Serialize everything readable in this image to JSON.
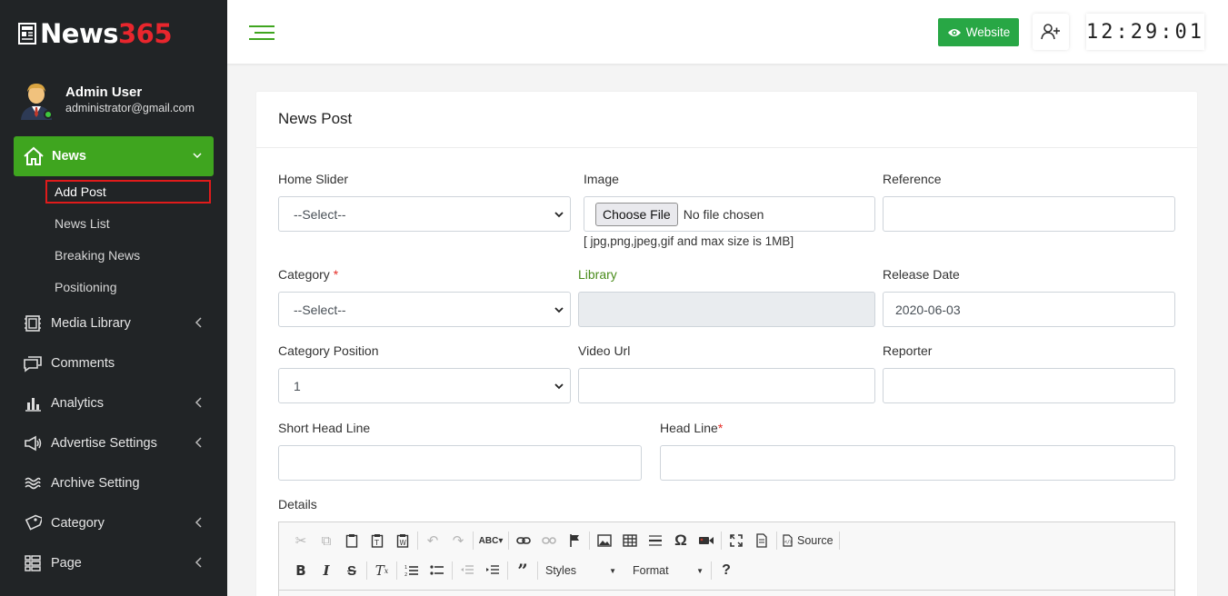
{
  "brand": {
    "name_part1": "News",
    "name_part2": "365"
  },
  "user": {
    "name": "Admin User",
    "email": "administrator@gmail.com"
  },
  "sidebar": {
    "active": {
      "label": "News",
      "icon": "home-icon"
    },
    "subitems": [
      "Add Post",
      "News List",
      "Breaking News",
      "Positioning"
    ],
    "selected_subitem": "Add Post",
    "items": [
      {
        "label": "Media Library",
        "icon": "media-library-icon",
        "has_children": true
      },
      {
        "label": "Comments",
        "icon": "comments-icon",
        "has_children": false
      },
      {
        "label": "Analytics",
        "icon": "bar-chart-icon",
        "has_children": true
      },
      {
        "label": "Advertise Settings",
        "icon": "megaphone-icon",
        "has_children": true
      },
      {
        "label": "Archive Setting",
        "icon": "archive-waves-icon",
        "has_children": false
      },
      {
        "label": "Category",
        "icon": "tag-icon",
        "has_children": true
      },
      {
        "label": "Page",
        "icon": "page-list-icon",
        "has_children": true
      }
    ]
  },
  "topbar": {
    "website_label": "Website",
    "clock": "12:29:01"
  },
  "form": {
    "title": "News Post",
    "home_slider": {
      "label": "Home Slider",
      "value": "--Select--"
    },
    "image": {
      "label": "Image",
      "button": "Choose File",
      "status": "No file chosen",
      "hint": "[ jpg,png,jpeg,gif and max size is 1MB]"
    },
    "reference": {
      "label": "Reference",
      "value": ""
    },
    "category": {
      "label": "Category",
      "required_mark": "*",
      "value": "--Select--"
    },
    "library": {
      "label": "Library",
      "value": ""
    },
    "release_date": {
      "label": "Release Date",
      "value": "2020-06-03"
    },
    "category_position": {
      "label": "Category Position",
      "value": "1"
    },
    "video_url": {
      "label": "Video Url",
      "value": ""
    },
    "reporter": {
      "label": "Reporter",
      "value": ""
    },
    "short_head_line": {
      "label": "Short Head Line",
      "value": ""
    },
    "head_line": {
      "label": "Head Line",
      "required_mark": "*",
      "value": ""
    },
    "details": {
      "label": "Details"
    }
  },
  "editor": {
    "source_label": "Source",
    "styles_label": "Styles",
    "format_label": "Format"
  },
  "colors": {
    "sidebar_bg": "#212426",
    "accent_green": "#3fa51f",
    "website_btn": "#28a745",
    "brand_red": "#e8262d",
    "highlight_red": "#e01b1b"
  }
}
